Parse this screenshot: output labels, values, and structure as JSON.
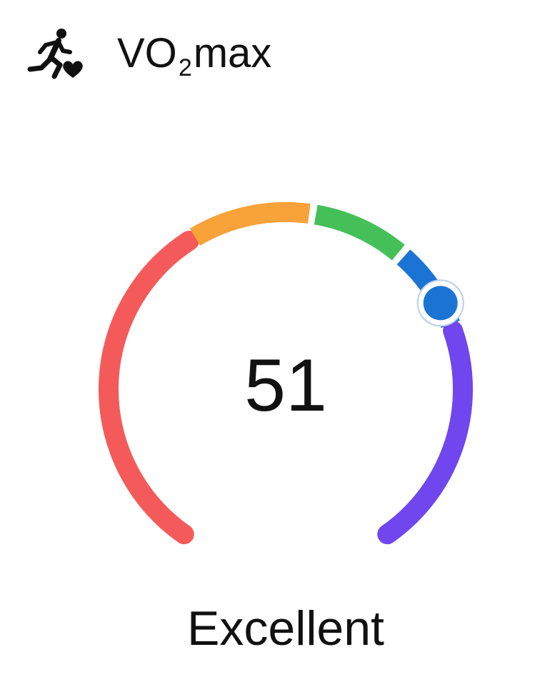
{
  "header": {
    "title_prefix": "VO",
    "title_subscript": "2",
    "title_suffix": " max",
    "icon": "runner-heart-icon"
  },
  "gauge": {
    "value": "51",
    "rating": "Excellent",
    "level_fraction": 0.71,
    "segments": [
      {
        "name": "red",
        "color": "#f55a5a",
        "from": 0.0,
        "to": 0.39
      },
      {
        "name": "orange",
        "color": "#f8a23a",
        "from": 0.39,
        "to": 0.53
      },
      {
        "name": "green",
        "color": "#45c059",
        "from": 0.53,
        "to": 0.64
      },
      {
        "name": "blue",
        "color": "#1b74d4",
        "from": 0.64,
        "to": 0.74
      },
      {
        "name": "purple",
        "color": "#7046ee",
        "from": 0.74,
        "to": 1.0
      }
    ],
    "indicator_color": "#1b74d4"
  }
}
